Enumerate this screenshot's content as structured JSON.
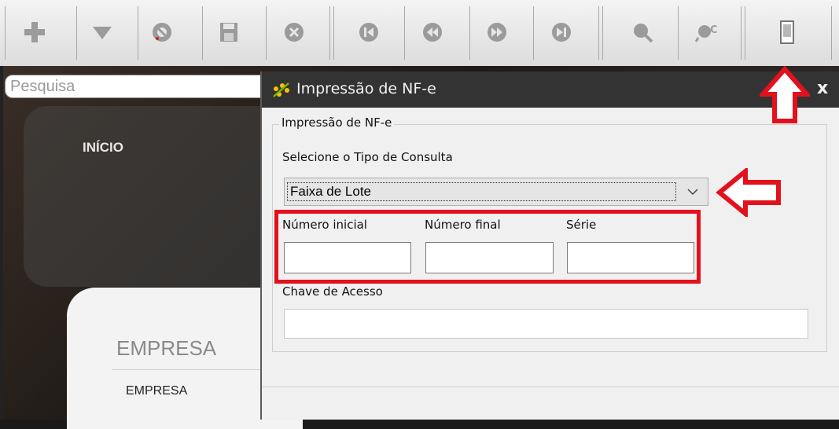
{
  "toolbar": {
    "buttons": [
      "add-icon",
      "dropdown-icon",
      "cancel-icon",
      "save-icon",
      "delete-icon",
      "first-record-icon",
      "previous-record-icon",
      "next-record-icon",
      "last-record-icon",
      "search-icon",
      "advanced-search-icon",
      "print-icon"
    ]
  },
  "background_app": {
    "search_placeholder": "Pesquisa",
    "nav_home": "INÍCIO",
    "section_heading": "EMPRESA",
    "section_item": "EMPRESA"
  },
  "dialog": {
    "title": "Impressão de NF-e",
    "close_label": "x",
    "group_title": "Impressão de NF-e",
    "query_type_label": "Selecione o Tipo de Consulta",
    "query_type_value": "Faixa de Lote",
    "fields": {
      "numero_inicial_label": "Número inicial",
      "numero_final_label": "Número final",
      "serie_label": "Série",
      "chave_acesso_label": "Chave de Acesso",
      "numero_inicial_value": "",
      "numero_final_value": "",
      "serie_value": "",
      "chave_acesso_value": ""
    }
  },
  "colors": {
    "annotation_red": "#e3101d",
    "dialog_titlebar": "#333333",
    "dialog_body": "#f0f0f0",
    "toolbar_icon_gray": "#9b9b9b"
  }
}
